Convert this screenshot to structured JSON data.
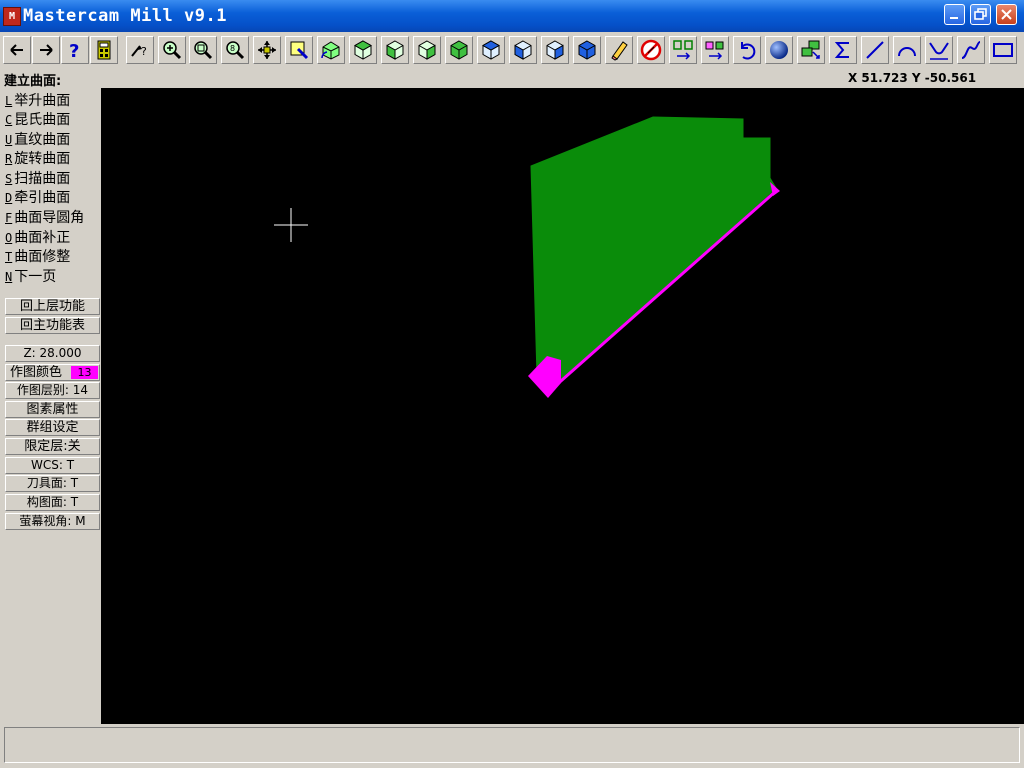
{
  "window": {
    "title": "Mastercam Mill v9.1",
    "icon_label": "M"
  },
  "window_controls": [
    "minimize",
    "maximize",
    "close"
  ],
  "toolbar": {
    "icons": [
      "arrow-left-icon",
      "arrow-right-icon",
      "help-icon",
      "calculator-icon",
      "analyze-icon",
      "zoom-window-icon",
      "zoom-unzoom-icon",
      "zoom-fit-icon",
      "pan-icon",
      "select-icon",
      "rotate-view-icon",
      "cube-top-icon",
      "cube-front-icon",
      "cube-side-icon",
      "cube-iso-icon",
      "cube-cplane-icon",
      "cube-view-icon",
      "cube-wcs-icon",
      "cube-tplane-icon",
      "eraser-icon",
      "no-delete-icon",
      "transform-icon",
      "mirror-icon",
      "undo-icon",
      "sphere-shade-icon",
      "layer-icon",
      "sum-icon",
      "line-icon",
      "arc-icon",
      "fillet-icon",
      "spline-icon",
      "rectangle-icon"
    ]
  },
  "prompt": {
    "label": "建立曲面:",
    "coords": "X 51.723  Y -50.561"
  },
  "menu": {
    "items": [
      {
        "hotkey": "L",
        "label": "举升曲面"
      },
      {
        "hotkey": "C",
        "label": "昆氏曲面"
      },
      {
        "hotkey": "U",
        "label": "直纹曲面"
      },
      {
        "hotkey": "R",
        "label": "旋转曲面"
      },
      {
        "hotkey": "S",
        "label": "扫描曲面"
      },
      {
        "hotkey": "D",
        "label": "牵引曲面"
      },
      {
        "hotkey": "F",
        "label": "曲面导圆角"
      },
      {
        "hotkey": "O",
        "label": "曲面补正"
      },
      {
        "hotkey": "T",
        "label": "曲面修整"
      },
      {
        "hotkey": "N",
        "label": "下一页"
      }
    ],
    "back": "回上层功能",
    "main": "回主功能表"
  },
  "status": {
    "z": "Z:  28.000",
    "color_label": "作图颜色",
    "color_value": "13",
    "layer": "作图层别: 14",
    "attributes": "图素属性",
    "group": "群组设定",
    "mask": "限定层:关",
    "wcs": "WCS:  T",
    "tplane": "刀具面: T",
    "cplane": "构图面: T",
    "gview": "萤幕视角: M"
  },
  "colors": {
    "title_bar": "#0a5fd8",
    "surface_green": "#0a8c0a",
    "highlight_magenta": "#ff00ff",
    "viewport_bg": "#000000"
  }
}
